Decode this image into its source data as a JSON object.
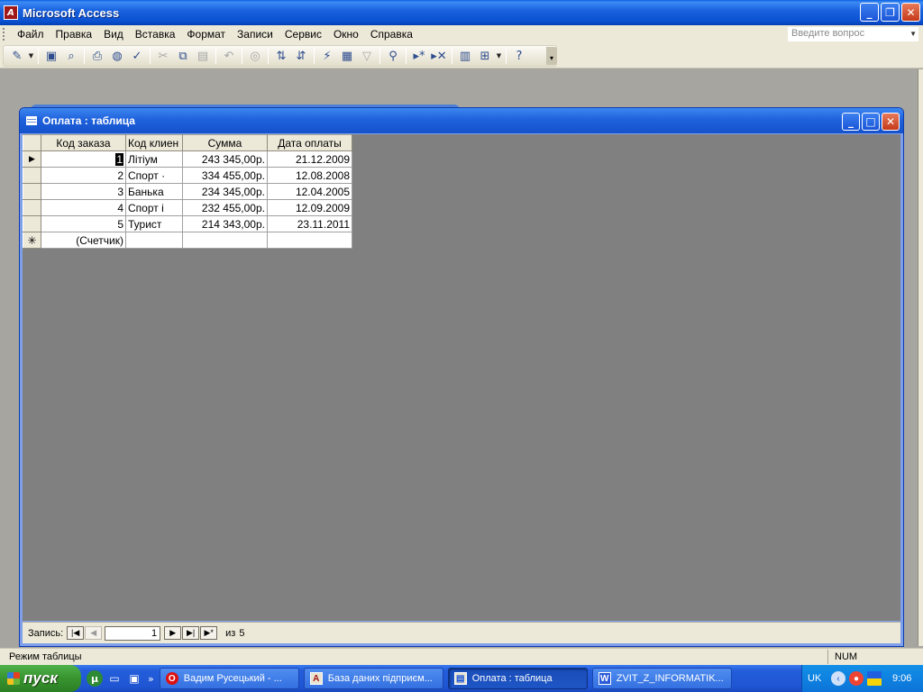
{
  "app": {
    "title": "Microsoft Access"
  },
  "menu": {
    "items": [
      "Файл",
      "Правка",
      "Вид",
      "Вставка",
      "Формат",
      "Записи",
      "Сервис",
      "Окно",
      "Справка"
    ],
    "help_placeholder": "Введите вопрос"
  },
  "toolbar": {
    "icons": [
      "view-design-icon",
      "dropdown-icon",
      "save-icon",
      "search-file-icon",
      "print-icon",
      "print-preview-icon",
      "spelling-icon",
      "cut-icon",
      "copy-icon",
      "paste-icon",
      "undo-icon",
      "hyperlink-icon",
      "sort-ascending-icon",
      "sort-descending-icon",
      "filter-by-selection-icon",
      "filter-by-form-icon",
      "apply-filter-icon",
      "find-icon",
      "new-record-icon",
      "delete-record-icon",
      "database-window-icon",
      "new-object-icon",
      "dropdown-icon",
      "help-icon"
    ]
  },
  "datasheet": {
    "window_title": "Оплата : таблица",
    "columns": [
      "Код заказа",
      "Код клиен",
      "Сумма",
      "Дата оплаты"
    ],
    "rows": [
      {
        "id": "1",
        "client": "Літіум",
        "sum": "243 345,00р.",
        "date": "21.12.2009"
      },
      {
        "id": "2",
        "client": "Спорт ·",
        "sum": "334 455,00р.",
        "date": "12.08.2008"
      },
      {
        "id": "3",
        "client": "Банька",
        "sum": "234 345,00р.",
        "date": "12.04.2005"
      },
      {
        "id": "4",
        "client": "Спорт і",
        "sum": "232 455,00р.",
        "date": "12.09.2009"
      },
      {
        "id": "5",
        "client": "Турист",
        "sum": "214 343,00р.",
        "date": "23.11.2011"
      }
    ],
    "new_row_placeholder": "(Счетчик)"
  },
  "navigation": {
    "label": "Запись:",
    "current_record": "1",
    "of_label": "из",
    "total_records": "5"
  },
  "status": {
    "mode": "Режим таблицы",
    "num": "NUM"
  },
  "taskbar": {
    "start_label": "пуск",
    "tasks": [
      {
        "label": "Вадим Русецький - ...",
        "icon": "opera-icon",
        "active": false
      },
      {
        "label": "База даних підприєм...",
        "icon": "access-database-icon",
        "active": false
      },
      {
        "label": "Оплата : таблица",
        "icon": "table-icon",
        "active": true
      },
      {
        "label": "ZVIT_Z_INFORMATIK...",
        "icon": "word-document-icon",
        "active": false
      }
    ],
    "language": "UK",
    "clock": "9:06"
  }
}
